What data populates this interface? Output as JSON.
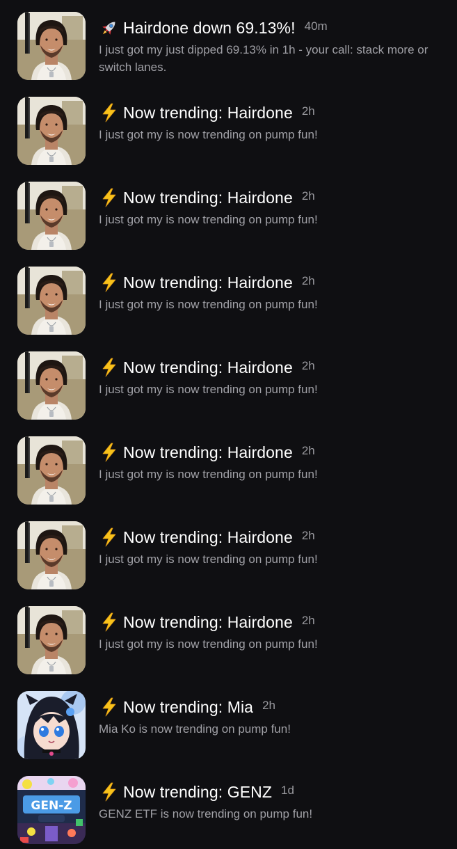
{
  "notifications": [
    {
      "icon": "rocket-icon",
      "title": "Hairdone down 69.13%!",
      "time": "40m",
      "body": "I just got my just dipped 69.13% in 1h - your call: stack more or switch lanes.",
      "avatar": "hairdone"
    },
    {
      "icon": "lightning-icon",
      "title": "Now trending: Hairdone",
      "time": "2h",
      "body": "I just got my is now trending on pump fun!",
      "avatar": "hairdone"
    },
    {
      "icon": "lightning-icon",
      "title": "Now trending: Hairdone",
      "time": "2h",
      "body": "I just got my is now trending on pump fun!",
      "avatar": "hairdone"
    },
    {
      "icon": "lightning-icon",
      "title": "Now trending: Hairdone",
      "time": "2h",
      "body": "I just got my is now trending on pump fun!",
      "avatar": "hairdone"
    },
    {
      "icon": "lightning-icon",
      "title": "Now trending: Hairdone",
      "time": "2h",
      "body": "I just got my is now trending on pump fun!",
      "avatar": "hairdone"
    },
    {
      "icon": "lightning-icon",
      "title": "Now trending: Hairdone",
      "time": "2h",
      "body": "I just got my is now trending on pump fun!",
      "avatar": "hairdone"
    },
    {
      "icon": "lightning-icon",
      "title": "Now trending: Hairdone",
      "time": "2h",
      "body": "I just got my is now trending on pump fun!",
      "avatar": "hairdone"
    },
    {
      "icon": "lightning-icon",
      "title": "Now trending: Hairdone",
      "time": "2h",
      "body": "I just got my is now trending on pump fun!",
      "avatar": "hairdone"
    },
    {
      "icon": "lightning-icon",
      "title": "Now trending: Mia",
      "time": "2h",
      "body": "Mia Ko is now trending on pump fun!",
      "avatar": "mia"
    },
    {
      "icon": "lightning-icon",
      "title": "Now trending: GENZ",
      "time": "1d",
      "body": "GENZ ETF is now trending on pump fun!",
      "avatar": "genz"
    }
  ],
  "colors": {
    "background": "#0f0f12",
    "title": "#ffffff",
    "secondary": "#a0a0a6"
  }
}
